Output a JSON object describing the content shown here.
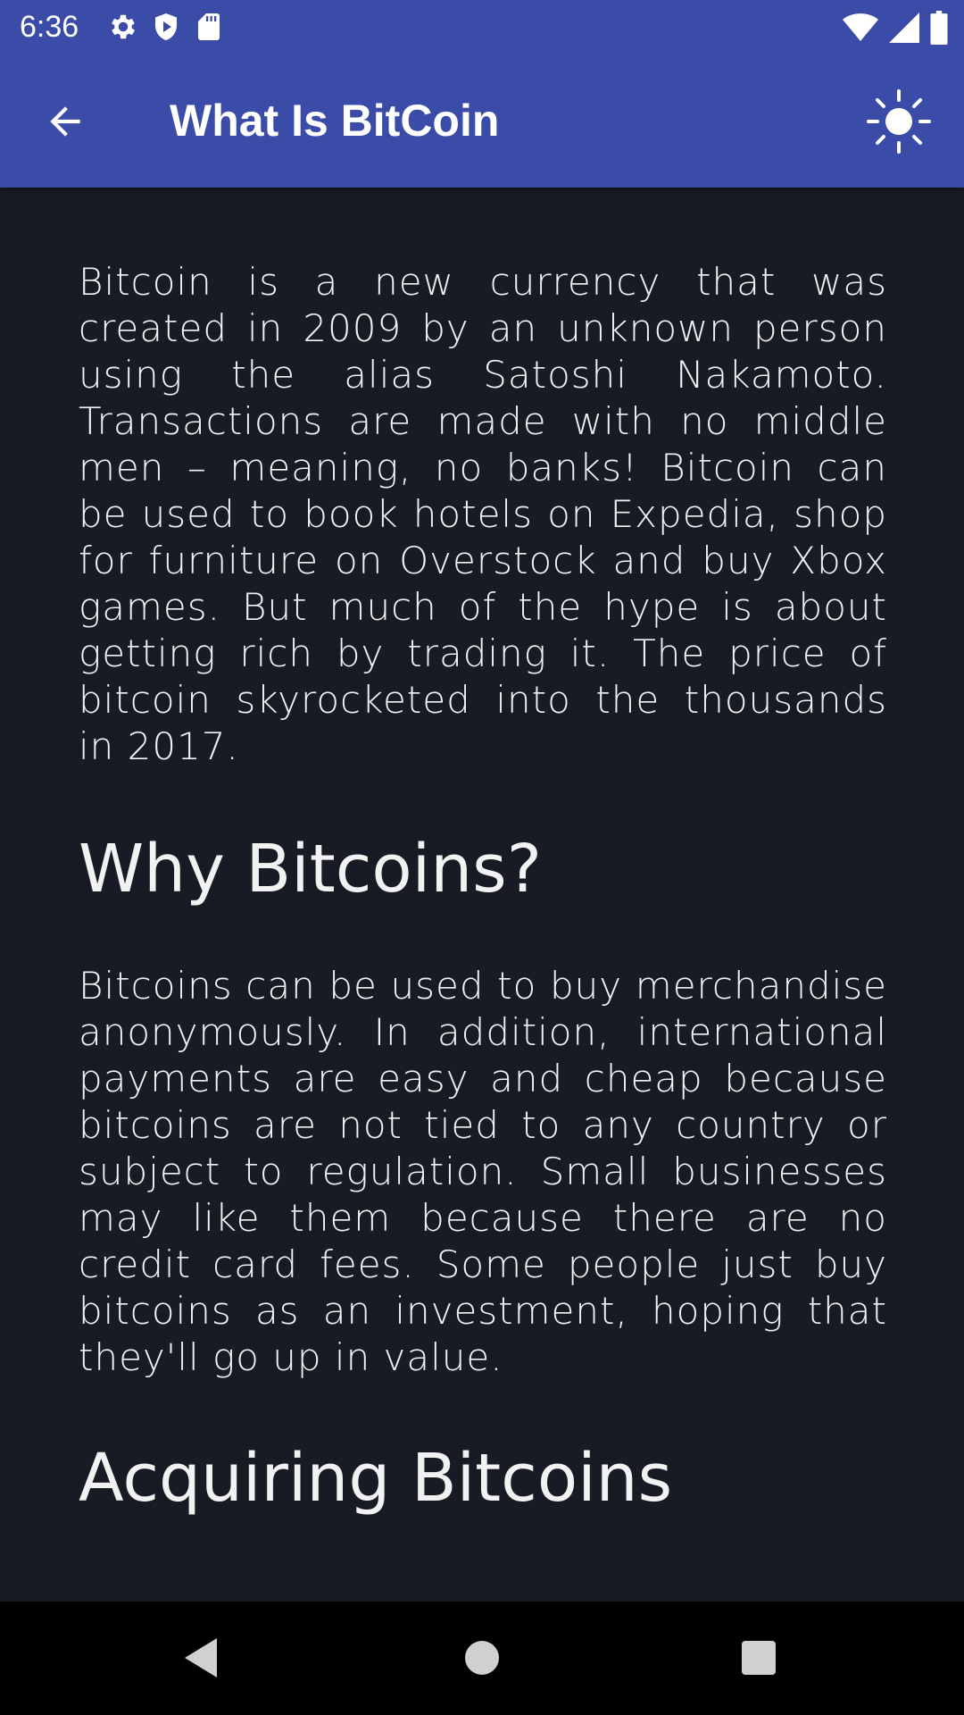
{
  "status_bar": {
    "time": "6:36",
    "left_icons": [
      "gear-icon",
      "shield-play-icon",
      "sd-card-icon"
    ],
    "right_icons": [
      "wifi-icon",
      "cell-signal-icon",
      "battery-icon"
    ]
  },
  "app_bar": {
    "title": "What Is BitCoin",
    "back_icon": "arrow-left-icon",
    "action_icon": "sun-icon",
    "background_color": "#3b4ba8"
  },
  "content": {
    "paragraph_1": "Bitcoin is a new currency that was created in 2009 by an unknown person using the alias Satoshi Nakamoto. Transactions are made with no middle men – meaning, no banks! Bitcoin can be used to book hotels on Expedia, shop for furniture on Overstock and buy Xbox games. But much of the hype is about getting rich by trading it. The price of bitcoin skyrocketed into the thousands in 2017.",
    "heading_1": "Why Bitcoins?",
    "paragraph_2": "Bitcoins can be used to buy merchandise anonymously. In addition, international payments are easy and cheap because bitcoins are not tied to any country or subject to regulation. Small businesses may like them because there are no credit card fees. Some people just buy bitcoins as an investment, hoping that they'll go up in value.",
    "heading_2": "Acquiring Bitcoins",
    "background_color": "#161b24",
    "text_color": "#f2f2f2"
  },
  "nav_bar": {
    "buttons": [
      "back-triangle-icon",
      "home-circle-icon",
      "recents-square-icon"
    ]
  }
}
